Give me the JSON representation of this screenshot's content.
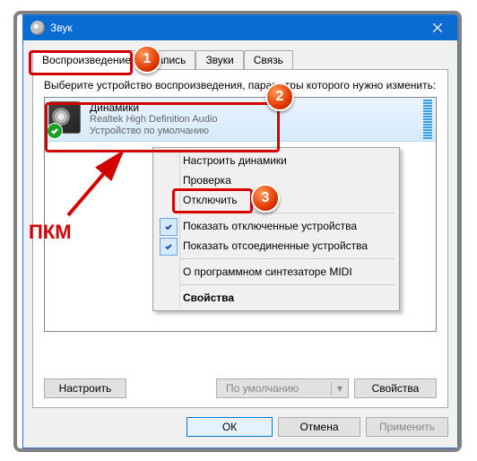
{
  "window": {
    "title": "Звук",
    "tabs": [
      "Воспроизведение",
      "Запись",
      "Звуки",
      "Связь"
    ]
  },
  "panel": {
    "instruction": "Выберите устройство воспроизведения, параметры которого нужно изменить:",
    "device": {
      "name": "Динамики",
      "desc1": "Realtek High Definition Audio",
      "desc2": "Устройство по умолчанию"
    },
    "configure_btn": "Настроить",
    "default_btn": "По умолчанию",
    "properties_btn": "Свойства"
  },
  "menu": {
    "configure": "Настроить динамики",
    "test": "Проверка",
    "disable": "Отключить",
    "show_disabled": "Показать отключенные устройства",
    "show_disconnected": "Показать отсоединенные устройства",
    "midi": "О программном синтезаторе MIDI",
    "properties": "Свойства"
  },
  "dialog_buttons": {
    "ok": "ОК",
    "cancel": "Отмена",
    "apply": "Применить"
  },
  "annotations": {
    "pkm": "ПКМ",
    "n1": "1",
    "n2": "2",
    "n3": "3"
  }
}
